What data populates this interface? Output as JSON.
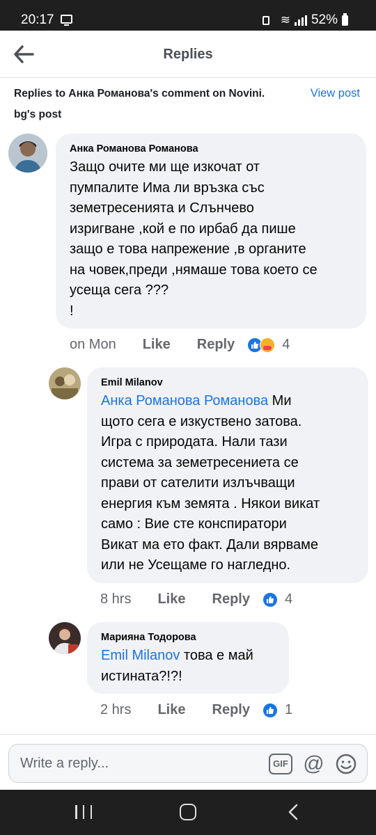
{
  "status_bar": {
    "time": "20:17",
    "battery_percent": "52%"
  },
  "header": {
    "title": "Replies"
  },
  "context": {
    "text": "Replies to Анка Романова's comment on Novini. bg's post",
    "view_post": "View post"
  },
  "comments": [
    {
      "name": "Анка Романова Романова",
      "body": "Защо очите ми ще изкочат от\nпумпалите  Има ли връзка със\nземетресенията и Слънчево\nизригване ,кой е по ирбаб да пише\nзащо е това напрежение ,в органите\nна човек,преди ,нямаше това което се\nусеща сега ???\n!",
      "time": "on Mon",
      "like": "Like",
      "reply": "Reply",
      "reactions": "4"
    },
    {
      "name": "Emil Milanov",
      "mention": "Анка Романова Романова",
      "body": " Ми\nщото сега е изкуствено затова.\nИгра с природата. Нали тази\nсистема за земетресениета се\nправи от сателити излъчващи\nенергия към земята . Някои викат\nсамо : Вие сте конспиратори\nВикат ма ето факт. Дали вярваме\nили не Усещаме го нагледно.",
      "time": "8 hrs",
      "like": "Like",
      "reply": "Reply",
      "reactions": "4"
    },
    {
      "name": "Марияна Тодорова",
      "mention": "Emil Milanov",
      "body": " това е май\nистината?!?!",
      "time": "2 hrs",
      "like": "Like",
      "reply": "Reply",
      "reactions": "1"
    }
  ],
  "composer": {
    "placeholder": "Write a reply...",
    "gif_label": "GIF",
    "at_label": "@"
  }
}
